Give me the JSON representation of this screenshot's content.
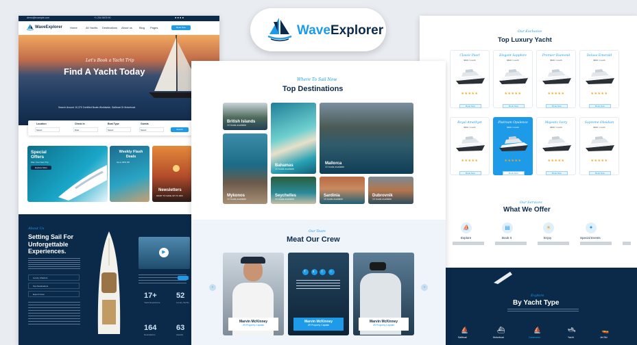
{
  "brand": {
    "name_prefix": "Wave",
    "name_suffix": "Explorer",
    "primary": "#1e9be8",
    "dark": "#0c2a4a",
    "logo_icon": "sailboat-icon"
  },
  "left_page": {
    "topbar_email": "demo@example.com",
    "topbar_phone": "+1 234 5678 90",
    "logo": "WaveExplorer",
    "nav": [
      "Home",
      "All Yachts",
      "Destinations",
      "About us",
      "Blog",
      "Pages"
    ],
    "cta": "Book Now",
    "hero": {
      "script": "Let's Book a Yacht Trip",
      "title": "Find A Yacht Today",
      "subtitle": "Search Around 10,370 Certified Boats Worldwide, Sailboat Or Motorboat"
    },
    "search": {
      "fields": [
        {
          "label": "Location",
          "value": "Select"
        },
        {
          "label": "Check In",
          "value": "Date"
        },
        {
          "label": "Boat Type",
          "value": "Select"
        },
        {
          "label": "Guests",
          "value": "Select"
        }
      ],
      "button": "Search"
    },
    "promos": [
      {
        "title": "Special Offers",
        "sub": "Plan Your Next Trip",
        "btn": "Explore More"
      },
      {
        "title": "Weekly Flash Deals",
        "sub": "Up to 30% Off"
      },
      {
        "title": "Newsletters",
        "sub": "WANT TO SAVE UP TO 30%"
      }
    ],
    "about": {
      "script": "About Us",
      "title": "Setting Sail For Unforgettable Experiences.",
      "list": [
        "Luxury Charters",
        "Top Destinations",
        "Expert Crew"
      ],
      "stats": [
        {
          "value": "17+",
          "label": "Years Experience"
        },
        {
          "value": "52",
          "label": "Luxury Yachts"
        },
        {
          "value": "164",
          "label": "Destinations"
        },
        {
          "value": "63",
          "label": "Awards"
        }
      ]
    }
  },
  "center_page": {
    "destinations": {
      "script": "Where To Sail Now",
      "title": "Top Destinations",
      "items": [
        {
          "name": "British Islands",
          "sub": "10 boats available"
        },
        {
          "name": "Bahamas",
          "sub": "10 boats available"
        },
        {
          "name": "Mallorca",
          "sub": "10 boats available"
        },
        {
          "name": "Mykonos",
          "sub": "10 boats available"
        },
        {
          "name": "Seychelles",
          "sub": "10 boats available"
        },
        {
          "name": "Sardinia",
          "sub": "10 boats available"
        },
        {
          "name": "Dubrovnik",
          "sub": "10 boats available"
        }
      ]
    },
    "crew": {
      "script": "Our Team",
      "title": "Meat Our Crew",
      "members": [
        {
          "name": "Marvin McKinney",
          "role": "JR Property Captain"
        },
        {
          "name": "Marvin McKinney",
          "role": "JR Property Captain"
        },
        {
          "name": "Marvin McKinney",
          "role": "JR Property Captain"
        }
      ]
    }
  },
  "right_page": {
    "yachts": {
      "script": "Our Exclusive",
      "title": "Top Luxury Yacht",
      "items": [
        {
          "name": "Classic Pearl",
          "price": "$600 / month",
          "btn": "Book Now"
        },
        {
          "name": "Elegant Sapphire",
          "price": "$600 / month",
          "btn": "Book Now"
        },
        {
          "name": "Premier Diamond",
          "price": "$600 / month",
          "btn": "Book Now"
        },
        {
          "name": "Deluxe Emerald",
          "price": "$600 / month",
          "btn": "Book Now"
        },
        {
          "name": "Royal Amethyst",
          "price": "$600 / month",
          "btn": "Book Now"
        },
        {
          "name": "Platinum Opulence",
          "price": "$600 / month",
          "btn": "Book Now"
        },
        {
          "name": "Majestic Ivory",
          "price": "$600 / month",
          "btn": "Book Now"
        },
        {
          "name": "Supreme Obsidian",
          "price": "$600 / month",
          "btn": "Book Now"
        }
      ],
      "stars": "★★★★★"
    },
    "offer": {
      "script": "Our Services",
      "title": "What We Offer",
      "items": [
        "Explore",
        "Book It",
        "Enjoy",
        "Special Events"
      ]
    },
    "types": {
      "script": "Explore",
      "title": "By Yacht Type",
      "items": [
        "Sailboat",
        "Motorboat",
        "Catamaran",
        "Yacht",
        "Jet Ski"
      ]
    }
  },
  "center_logo": {
    "prefix": "Wave",
    "suffix": "Explorer"
  }
}
